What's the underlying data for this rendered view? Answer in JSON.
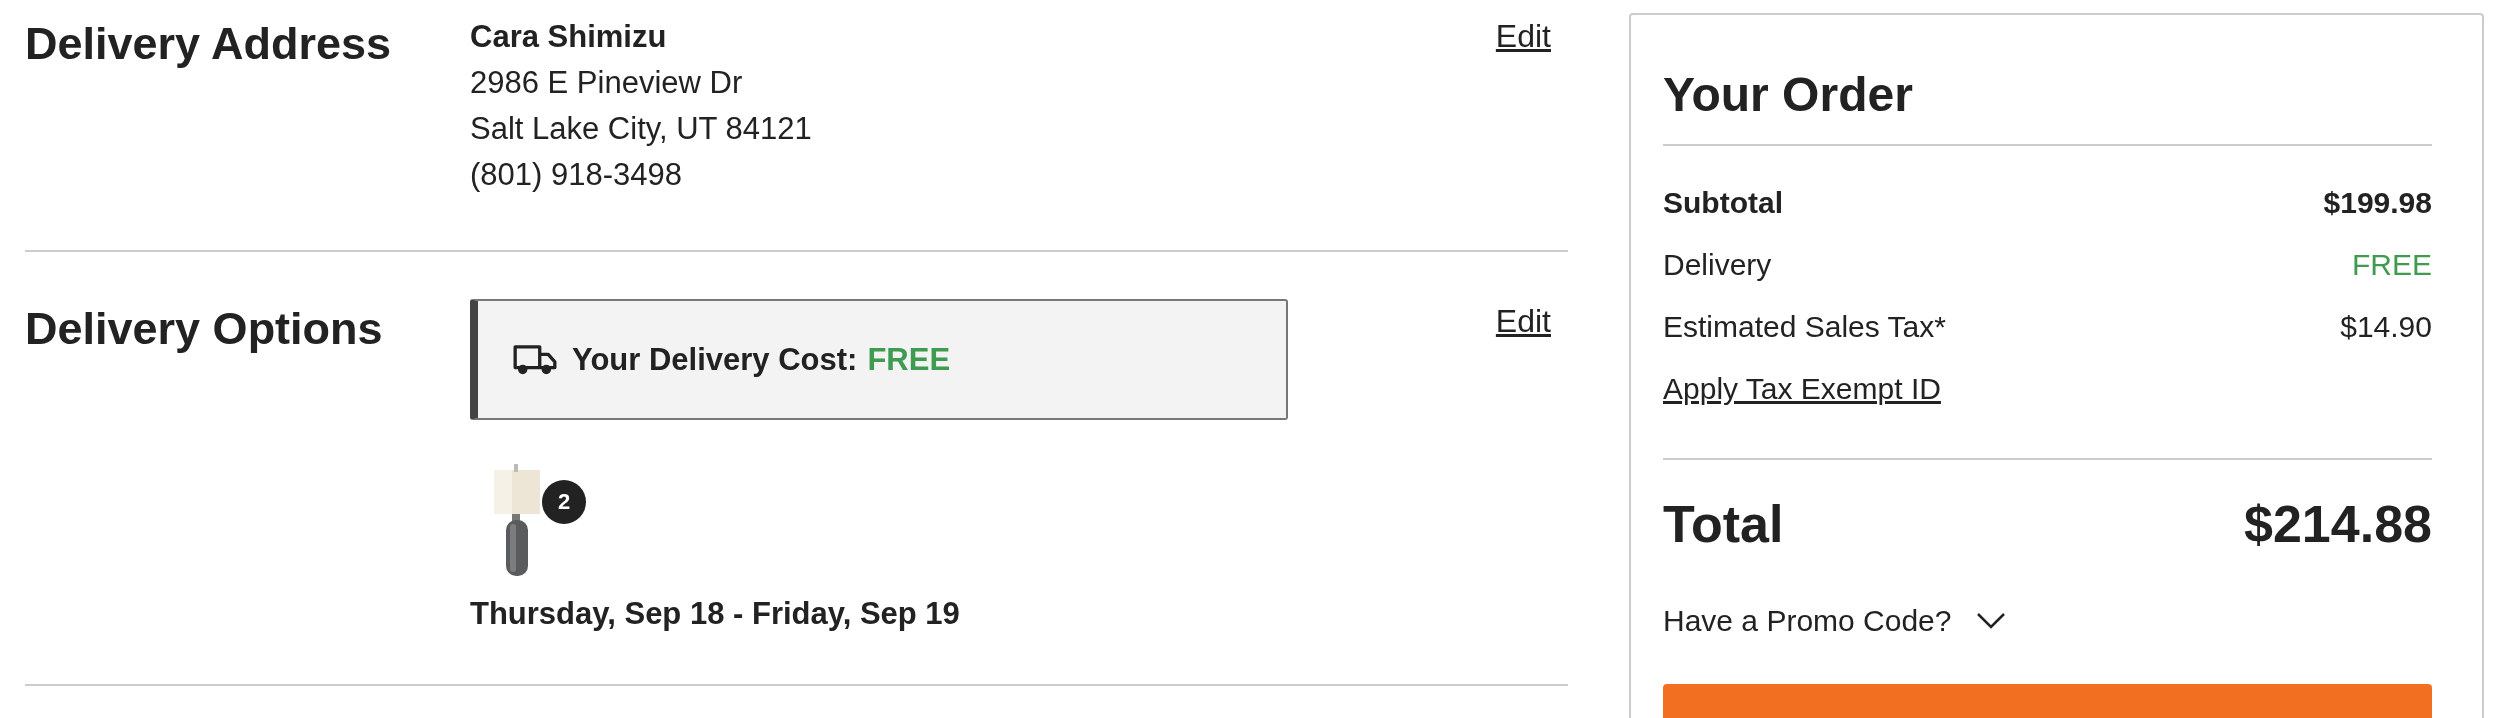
{
  "sections": [
    {
      "title": "Delivery Address",
      "edit": "Edit",
      "kind": "address",
      "name": "Cara Shimizu",
      "lines": [
        "2986 E Pineview Dr",
        "Salt Lake City, UT 84121",
        "(801) 918-3498"
      ]
    },
    {
      "title": "Delivery Options",
      "edit": "Edit",
      "kind": "options",
      "cost_label": "Your Delivery Cost:",
      "cost_value": "FREE",
      "item": {
        "kind": "picture",
        "quantity": "2"
      },
      "date": "Thursday, Sep 18 - Friday, Sep 19"
    }
  ],
  "order": {
    "title": "Your Order",
    "rows": [
      {
        "label": "Subtotal",
        "value": "$199.98",
        "kind": "bold"
      },
      {
        "label": "Delivery",
        "value": "FREE",
        "kind": "free"
      },
      {
        "label": "Estimated Sales Tax*",
        "value": "$14.90",
        "kind": "plain"
      }
    ],
    "tax_link": "Apply Tax Exempt ID",
    "total_label": "Total",
    "total_value": "$214.88",
    "promo": "Have a Promo Code?",
    "expanded": false
  }
}
